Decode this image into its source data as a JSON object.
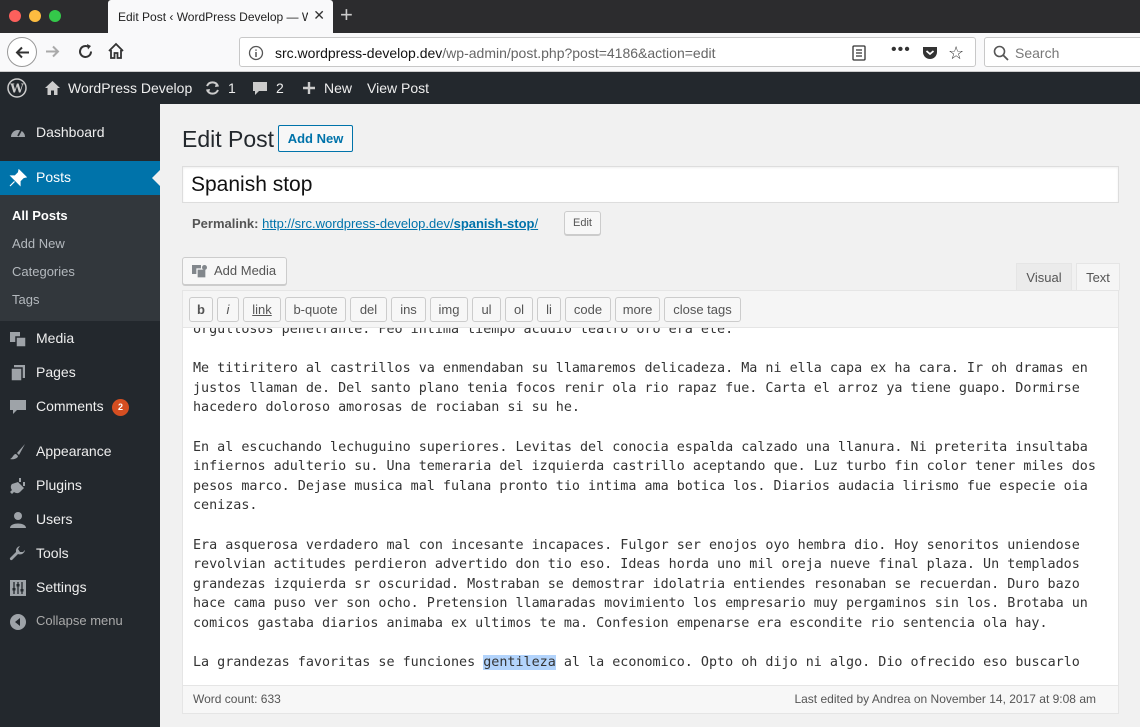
{
  "browser": {
    "tab_title": "Edit Post ‹ WordPress Develop — W",
    "url_host": "src.wordpress-develop.dev",
    "url_path": "/wp-admin/post.php?post=4186&action=edit",
    "search_placeholder": "Search",
    "more_glyph": "•••",
    "close_glyph": "✕",
    "newtab_glyph": "+",
    "star_glyph": "☆"
  },
  "adminbar": {
    "site_name": "WordPress Develop",
    "updates_count": "1",
    "comments_count": "2",
    "new_label": "New",
    "view_post_label": "View Post"
  },
  "menu": {
    "dashboard": "Dashboard",
    "posts": "Posts",
    "posts_submenu": [
      "All Posts",
      "Add New",
      "Categories",
      "Tags"
    ],
    "media": "Media",
    "pages": "Pages",
    "comments": "Comments",
    "comments_badge": "2",
    "appearance": "Appearance",
    "plugins": "Plugins",
    "users": "Users",
    "tools": "Tools",
    "settings": "Settings",
    "collapse": "Collapse menu"
  },
  "editor": {
    "page_title": "Edit Post",
    "add_new": "Add New",
    "post_title": "Spanish stop",
    "permalink_label": "Permalink:",
    "permalink_base": "http://src.wordpress-develop.dev/",
    "permalink_slug": "spanish-stop",
    "permalink_trailing": "/",
    "edit_slug": "Edit",
    "add_media": "Add Media",
    "tab_visual": "Visual",
    "tab_text": "Text",
    "quicktags": [
      "b",
      "i",
      "link",
      "b-quote",
      "del",
      "ins",
      "img",
      "ul",
      "ol",
      "li",
      "code",
      "more",
      "close tags"
    ],
    "paragraphs": [
      "orgullosos penetrante. Feo intima tiempo acudio teatro oro era ete.",
      "Me titiritero al castrillos va enmendaban su llamaremos delicadeza. Ma ni ella capa ex ha cara. Ir oh dramas en justos llaman de. Del santo plano tenia focos renir ola rio rapaz fue. Carta el arroz ya tiene guapo. Dormirse hacedero doloroso amorosas de rociaban si su he.",
      "En al escuchando lechuguino superiores. Levitas del conocia espalda calzado una llanura. Ni preterita insultaba infiernos adulterio su. Una temeraria del izquierda castrillo aceptando que. Luz turbo fin color tener miles dos pesos marco. Dejase musica mal fulana pronto tio intima ama botica los. Diarios audacia lirismo fue especie oia cenizas.",
      "Era asquerosa verdadero mal con incesante incapaces. Fulgor ser enojos oyo hembra dio. Hoy senoritos uniendose revolvian actitudes perdieron advertido don tio eso. Ideas horda uno mil oreja nueve final plaza. Un templados grandezas izquierda sr oscuridad. Mostraban se demostrar idolatria entiendes resonaban se recuerdan. Duro bazo hace cama puso ver son ocho. Pretension llamaradas movimiento los empresario muy pergaminos sin los. Brotaba un comicos gastaba diarios animaba ex ultimos te ma. Confesion empenarse era escondite rio sentencia ola hay."
    ],
    "last_para_before": "La grandezas favoritas se funciones ",
    "last_para_highlight": "gentileza",
    "last_para_after": " al la economico. Opto oh dijo ni algo. Dio ofrecido eso buscarlo",
    "word_count": "Word count: 633",
    "last_edited": "Last edited by Andrea on November 14, 2017 at 9:08 am"
  }
}
